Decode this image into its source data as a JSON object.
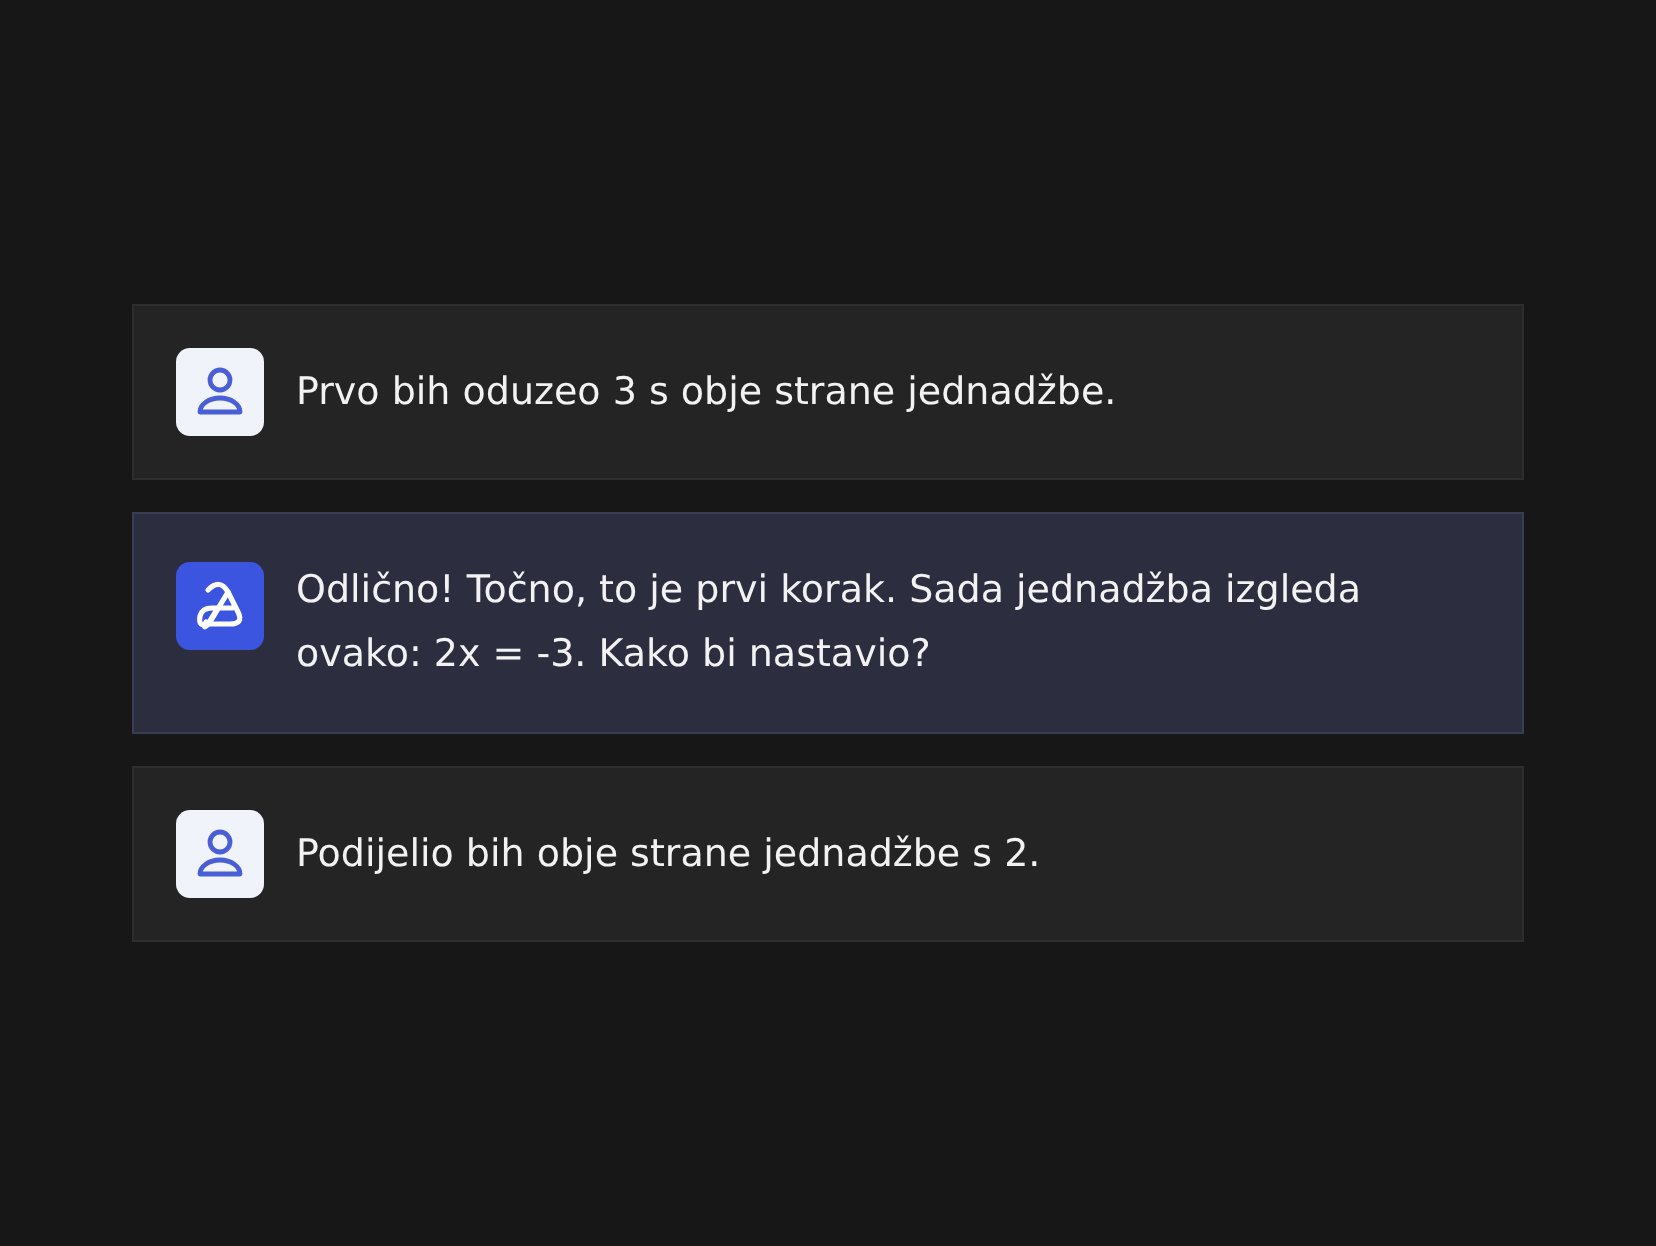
{
  "messages": [
    {
      "kind": "user",
      "text": "Prvo bih oduzeo 3 s obje strane jednadžbe."
    },
    {
      "kind": "assistant",
      "text": "Odlično! Točno, to je prvi korak. Sada jednadžba izgleda ovako: 2x = -3. Kako bi nastavio?"
    },
    {
      "kind": "user",
      "text": "Podijelio bih obje strane jednadžbe s 2."
    }
  ]
}
